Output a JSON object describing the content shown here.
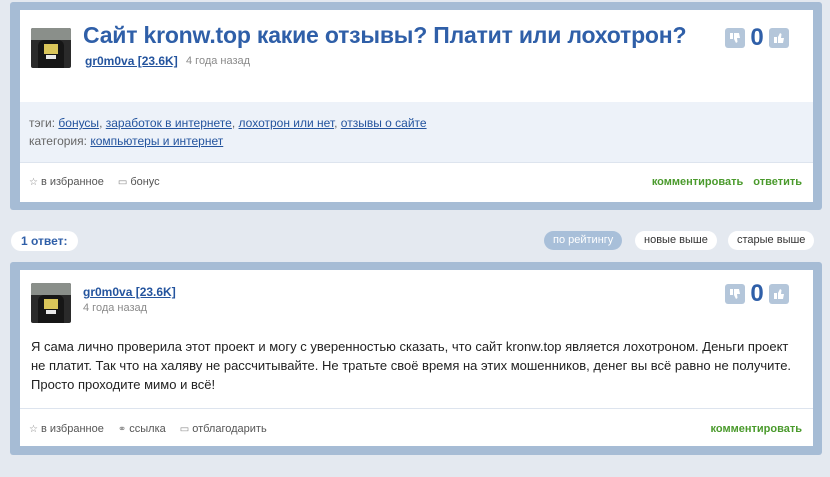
{
  "question": {
    "title": "Сайт kronw.top какие отзывы? Платит или лохотрон?",
    "author": "gr0m0va [23.6K]",
    "time": "4 года назад",
    "vote_count": "0",
    "tags_label": "тэги:",
    "tags": [
      "бонусы",
      "заработок в интернете",
      "лохотрон или нет",
      "отзывы о сайте"
    ],
    "category_label": "категория:",
    "category": "компьютеры и интернет",
    "footer": {
      "favorite": "в избранное",
      "bonus": "бонус",
      "comment": "комментировать",
      "answer": "ответить"
    }
  },
  "answers_header": {
    "count_label": "1 ответ:",
    "sort_options": [
      "по рейтингу",
      "новые выше",
      "старые выше"
    ],
    "active_sort": "по рейтингу"
  },
  "answer": {
    "author": "gr0m0va [23.6K]",
    "time": "4 года назад",
    "vote_count": "0",
    "text": "Я сама лично проверила этот проект и могу с уверенностью сказать, что сайт kronw.top является лохотроном. Деньги проект не платит. Так что на халяву не рассчитывайте. Не тратьте своё время на этих мошенников, денег вы всё равно не получите. Просто проходите мимо и всё!",
    "footer": {
      "favorite": "в избранное",
      "link": "ссылка",
      "thank": "отблагодарить",
      "comment": "комментировать"
    }
  },
  "colors": {
    "accent": "#2f5fa8",
    "link": "#24549e",
    "green": "#4a9a2c",
    "frame": "#a6bcd5"
  }
}
